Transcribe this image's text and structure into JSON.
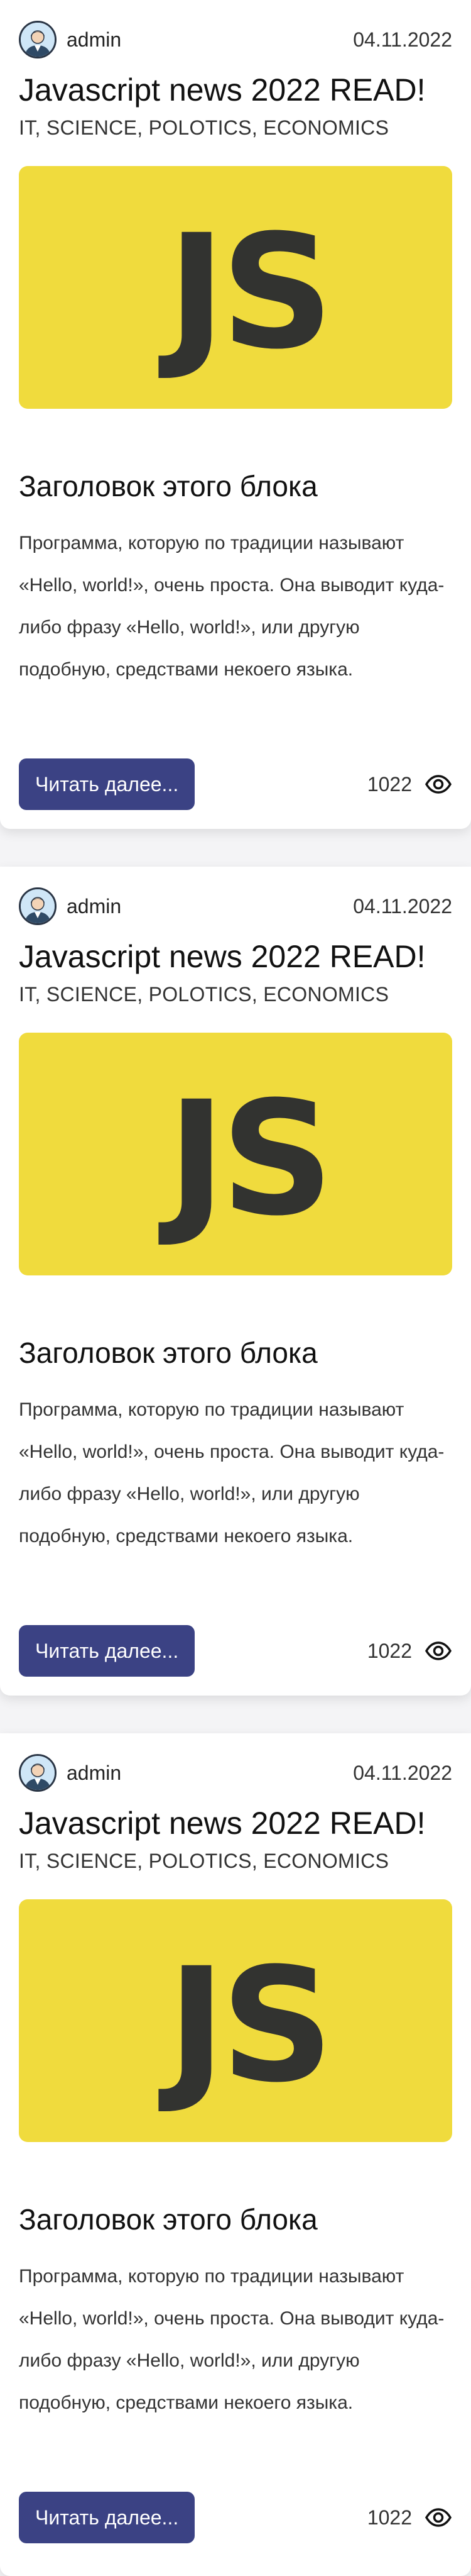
{
  "posts": [
    {
      "author": "admin",
      "date": "04.11.2022",
      "title": "Javascript news 2022 READ!",
      "tags": "IT, SCIENCE, POLOTICS, ECONOMICS",
      "cover_text": "JS",
      "block_title": "Заголовок этого блока",
      "excerpt": "Программа, которую по традиции называют «Hello, world!», очень проста. Она выводит куда-либо фразу «Hello, world!», или другую подобную, средствами некоего языка.",
      "read_more": "Читать далее...",
      "views": "1022"
    },
    {
      "author": "admin",
      "date": "04.11.2022",
      "title": "Javascript news 2022 READ!",
      "tags": "IT, SCIENCE, POLOTICS, ECONOMICS",
      "cover_text": "JS",
      "block_title": "Заголовок этого блока",
      "excerpt": "Программа, которую по традиции называют «Hello, world!», очень проста. Она выводит куда-либо фразу «Hello, world!», или другую подобную, средствами некоего языка.",
      "read_more": "Читать далее...",
      "views": "1022"
    },
    {
      "author": "admin",
      "date": "04.11.2022",
      "title": "Javascript news 2022 READ!",
      "tags": "IT, SCIENCE, POLOTICS, ECONOMICS",
      "cover_text": "JS",
      "block_title": "Заголовок этого блока",
      "excerpt": "Программа, которую по традиции называют «Hello, world!», очень проста. Она выводит куда-либо фразу «Hello, world!», или другую подобную, средствами некоего языка.",
      "read_more": "Читать далее...",
      "views": "1022"
    }
  ],
  "icons": {
    "avatar": "user-avatar-icon",
    "views": "eye-icon"
  },
  "colors": {
    "cover_background": "#f0db3d",
    "cover_logo": "#323330",
    "button_background": "#3b4284",
    "button_text": "#ffffff"
  }
}
